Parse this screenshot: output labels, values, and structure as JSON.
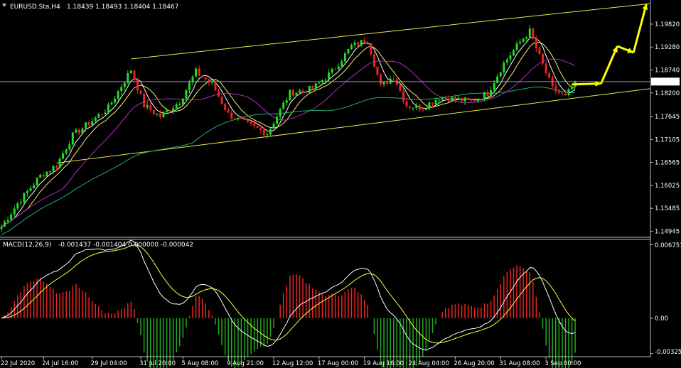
{
  "window": {
    "symbol_header": "EURUSD.Sta,H4",
    "ohlc": "1.18439 1.18493 1.18404 1.18467"
  },
  "macd_header": {
    "label": "MACD(12,26,9)",
    "values": "-0.001437 -0.001404 0.000000 -0.000042"
  },
  "colors": {
    "background": "#000000",
    "bull_candle": "#22dd22",
    "bear_candle": "#ee2222",
    "channel": "#e8e84a",
    "forecast_arrow": "#ffff00",
    "ma_fast": "#ffffff",
    "ma_mid": "#f0f070",
    "ma_slow": "#b030c0",
    "ma_long": "#20b070",
    "macd_line": "#ffffff",
    "signal_line": "#ffff40",
    "hist_pos": "#ee2222",
    "hist_neg": "#22aa22",
    "axis": "#c0c0c0"
  },
  "chart_data": {
    "type": "candlestick",
    "symbol": "EURUSD.Sta",
    "timeframe": "H4",
    "current_price": "1.18467",
    "price_axis_ticks": [
      "1.19820",
      "1.19280",
      "1.18740",
      "1.18200",
      "1.17645",
      "1.17105",
      "1.16565",
      "1.16025",
      "1.15485",
      "1.14945"
    ],
    "time_axis_ticks": [
      "22 Jul 2020",
      "24 Jul 16:00",
      "29 Jul 04:00",
      "31 Jul 20:00",
      "5 Aug 08:00",
      "9 Aug 21:00",
      "12 Aug 12:00",
      "17 Aug 00:00",
      "19 Aug 16:00",
      "24 Aug 04:00",
      "26 Aug 20:00",
      "31 Aug 08:00",
      "3 Sep 00:00"
    ],
    "ylim": [
      1.1487,
      1.2032
    ],
    "price_path": [
      {
        "i": 0,
        "p": 1.1505
      },
      {
        "i": 5,
        "p": 1.156
      },
      {
        "i": 12,
        "p": 1.1625
      },
      {
        "i": 17,
        "p": 1.165
      },
      {
        "i": 22,
        "p": 1.172
      },
      {
        "i": 28,
        "p": 1.1755
      },
      {
        "i": 33,
        "p": 1.1785
      },
      {
        "i": 40,
        "p": 1.1875
      },
      {
        "i": 44,
        "p": 1.179
      },
      {
        "i": 49,
        "p": 1.1765
      },
      {
        "i": 55,
        "p": 1.18
      },
      {
        "i": 60,
        "p": 1.187
      },
      {
        "i": 65,
        "p": 1.184
      },
      {
        "i": 70,
        "p": 1.177
      },
      {
        "i": 76,
        "p": 1.1745
      },
      {
        "i": 82,
        "p": 1.1725
      },
      {
        "i": 89,
        "p": 1.182
      },
      {
        "i": 96,
        "p": 1.183
      },
      {
        "i": 102,
        "p": 1.187
      },
      {
        "i": 108,
        "p": 1.193
      },
      {
        "i": 113,
        "p": 1.1945
      },
      {
        "i": 117,
        "p": 1.1835
      },
      {
        "i": 121,
        "p": 1.186
      },
      {
        "i": 125,
        "p": 1.179
      },
      {
        "i": 130,
        "p": 1.1785
      },
      {
        "i": 135,
        "p": 1.181
      },
      {
        "i": 140,
        "p": 1.1805
      },
      {
        "i": 145,
        "p": 1.18
      },
      {
        "i": 150,
        "p": 1.182
      },
      {
        "i": 155,
        "p": 1.189
      },
      {
        "i": 160,
        "p": 1.194
      },
      {
        "i": 163,
        "p": 1.1965
      },
      {
        "i": 166,
        "p": 1.1905
      },
      {
        "i": 170,
        "p": 1.183
      },
      {
        "i": 174,
        "p": 1.181
      },
      {
        "i": 177,
        "p": 1.1846
      }
    ],
    "channel_upper": [
      {
        "i": 40,
        "p": 1.19
      },
      {
        "i": 200,
        "p": 1.203
      }
    ],
    "channel_lower": [
      {
        "i": 17,
        "p": 1.1655
      },
      {
        "i": 200,
        "p": 1.183
      }
    ],
    "forecast_path": [
      {
        "i": 176,
        "p": 1.184
      },
      {
        "i": 185,
        "p": 1.1842
      },
      {
        "i": 190,
        "p": 1.193
      },
      {
        "i": 195,
        "p": 1.1915
      },
      {
        "i": 199,
        "p": 1.203
      }
    ],
    "macd_axis_ticks": [
      "0.006751",
      "0.00",
      "-0.003256"
    ],
    "macd_ylim": [
      -0.0034,
      0.0069
    ]
  }
}
